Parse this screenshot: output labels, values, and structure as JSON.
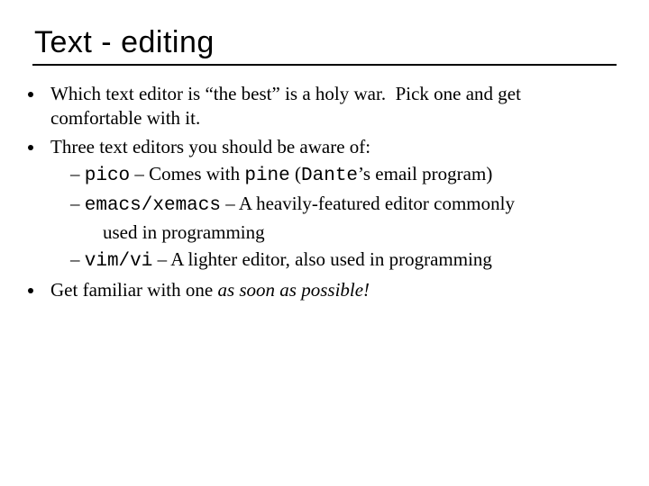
{
  "title": "Text - editing",
  "b1": "Which text editor is “the best” is a holy war.  Pick one and get comfortable with it.",
  "b2": "Three text editors you should be aware of:",
  "s1_code": "pico",
  "s1_t1": " – Comes with ",
  "s1_code2": "pine",
  "s1_t2": " (",
  "s1_code3": "Dante",
  "s1_t3": "’s email program)",
  "s2_code": "emacs/xemacs",
  "s2_t1": " – A heavily-featured editor commonly",
  "s2_t2": "used in programming",
  "s3_code": "vim/vi",
  "s3_t1": " – A lighter editor, also used in programming",
  "b3a": "Get familiar with one ",
  "b3b": "as soon as possible!"
}
